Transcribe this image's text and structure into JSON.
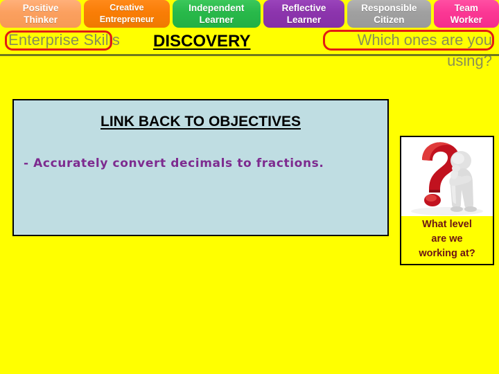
{
  "banner": {
    "name": "personal-learning-thinking-skills-banner",
    "tabs": [
      {
        "id": "positive-thinker",
        "line1": "Positive",
        "line2": "Thinker",
        "color": "#fba05f"
      },
      {
        "id": "creative-entrepreneur",
        "line1": "Creative",
        "line2": "Entrepreneur",
        "color": "#f97d06"
      },
      {
        "id": "independent-learner",
        "line1": "Independent",
        "line2": "Learner",
        "color": "#28b94a"
      },
      {
        "id": "reflective-learner",
        "line1": "Reflective",
        "line2": "Learner",
        "color": "#8c34ad"
      },
      {
        "id": "responsible-citizen",
        "line1": "Responsible",
        "line2": "Citizen",
        "color": "#a0a0a0"
      },
      {
        "id": "team-worker",
        "line1": "Team",
        "line2": "Worker",
        "color": "#fb3794"
      }
    ]
  },
  "header": {
    "enterprise_skills": "Enterprise Skills",
    "discovery": "DISCOVERY",
    "which_ones_line1": "Which ones are you",
    "which_ones_line2": "using?",
    "highlight_color": "#e21c13",
    "heading_text_color": "#8a8f55",
    "rule_color": "#6f7a1e"
  },
  "objectives": {
    "title": "LINK BACK TO OBJECTIVES",
    "items": [
      "- Accurately convert decimals to fractions."
    ],
    "panel_color": "#bfdde2",
    "item_text_color": "#7d2b8f"
  },
  "question_panel": {
    "image_alt": "question-mark-thinking-person",
    "caption_line1": "What level",
    "caption_line2": "are we",
    "caption_line3": "working at?",
    "caption_color": "#6b1414",
    "question_mark_color": "#c1121f",
    "figure_color": "#d9d9d9",
    "background_color": "#ffff00"
  },
  "page": {
    "background_color": "#ffff00"
  }
}
